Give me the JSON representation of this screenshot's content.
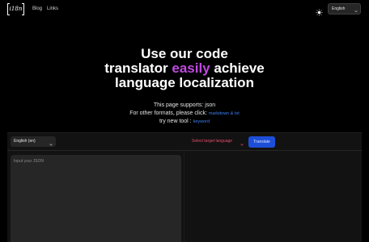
{
  "nav": {
    "logo_text": "i18n",
    "blog": "Blog",
    "links": "Links",
    "language": "English",
    "icons": {
      "theme": "sun-icon",
      "dropdown": "chevron-down-icon"
    }
  },
  "hero": {
    "line1": "Use our code",
    "line2_before": "translator ",
    "line2_accent": "easily",
    "line2_after": " achieve",
    "line3": "language localization",
    "accent_color": "#c04ae0"
  },
  "supports": {
    "label": "This page supports:",
    "format": "json",
    "other_label": "For other formats, please click:",
    "other_link": "markdown & txt",
    "tool_label": "try new tool :",
    "tool_link": "keyword"
  },
  "editor": {
    "source_lang": "English (en)",
    "target_placeholder": "Select target language",
    "translate_label": "Translate",
    "input_placeholder": "Input your JSON"
  },
  "colors": {
    "background": "#000000",
    "link": "#3b82f6",
    "translate_button": "#1d4ed8",
    "target_text": "#e74c6b"
  }
}
